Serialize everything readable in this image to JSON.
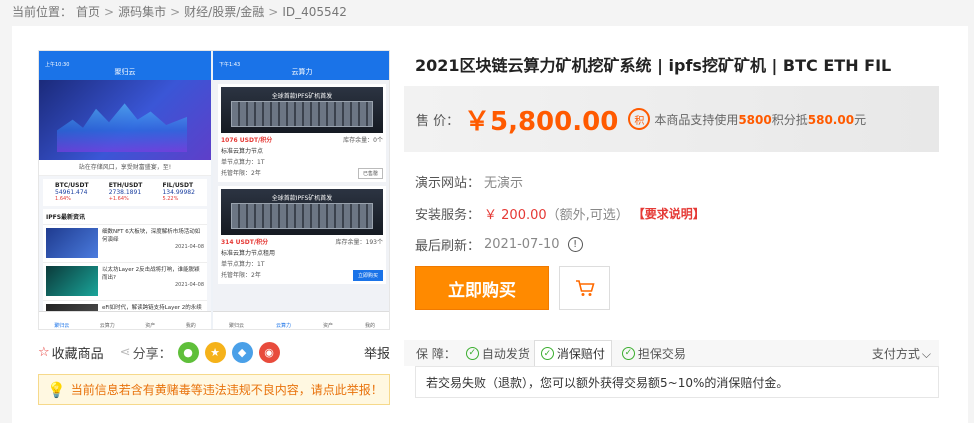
{
  "breadcrumb": {
    "label": "当前位置：",
    "items": [
      "首页",
      "源码集市",
      "财经/股票/金融",
      "ID_405542"
    ],
    "separator": ">"
  },
  "product": {
    "title": "2021区块链云算力矿机挖矿系统 | ipfs挖矿矿机 | BTC ETH FIL",
    "price_label": "售 价：",
    "price": "￥5,800.00",
    "points_icon": "积",
    "points_prefix": "本商品支持使用",
    "points_amount": "5800",
    "points_mid": "积分抵",
    "points_value": "580.00",
    "points_suffix": "元",
    "demo_label": "演示网站：",
    "demo_value": "无演示",
    "install_label": "安装服务：",
    "install_price": "￥ 200.00",
    "install_note": "（额外,可选）",
    "install_req": "【要求说明】",
    "refresh_label": "最后刷新：",
    "refresh_date": "2021-07-10",
    "refresh_icon": "!",
    "buy_label": "立即购买"
  },
  "share": {
    "favorite": "收藏商品",
    "share_label": "分享：",
    "report": "举报",
    "icons": [
      "wechat-icon",
      "qzone-icon",
      "qq-icon",
      "weibo-icon"
    ],
    "icon_colors": [
      "#5fbf3a",
      "#f5b21a",
      "#4aa0e8",
      "#e84b3c"
    ]
  },
  "warning": "当前信息若含有黄赌毒等违法违规不良内容，请点此举报！",
  "guarantee": {
    "label": "保 障：",
    "items": [
      "自动发货",
      "消保赔付",
      "担保交易"
    ],
    "pay_label": "支付方式",
    "description": "若交易失败（退款），您可以额外获得交易额5~10%的消保赔付金。"
  },
  "screenshot": {
    "p1": {
      "status": "上午10:30",
      "header": "聚归云",
      "notice": "站在存储风口，享受财富盛宴，至!",
      "coins": [
        {
          "name": "BTC/USDT",
          "value": "54961.474",
          "change": "1.64%"
        },
        {
          "name": "ETH/USDT",
          "value": "2738.1891",
          "change": "+1.64%"
        },
        {
          "name": "FIL/USDT",
          "value": "134.99982",
          "change": "5.22%"
        }
      ],
      "news_title": "IPFS最新资讯",
      "news": [
        {
          "text": "细数NFT 6大板块，深度解析市场活动如何演绎",
          "date": "2021-04-08"
        },
        {
          "text": "以太坊Layer 2反击战将打响，谁能脱颖而出?",
          "date": "2021-04-08"
        },
        {
          "text": "eFi如时代，解读跨链支持Layer 2的永续合约DEX",
          "date": "2021-03-08"
        }
      ],
      "tabs": [
        "聚归云",
        "云算力",
        "资产",
        "我的"
      ]
    },
    "p2": {
      "status": "下午1:43",
      "header": "云算力",
      "cards": [
        {
          "banner": "全球首款IPFS矿机首发",
          "price": "1076 USDT/积分",
          "stock": "库存余量：0个",
          "name": "标准云算力节点",
          "unit": "单节点算力：1T",
          "period": "托管年限：2年",
          "btn": "已售罄"
        },
        {
          "banner": "全球首款IPFS矿机首发",
          "price": "314 USDT/积分",
          "stock": "库存余量：193个",
          "name": "标准云算力节点租用",
          "unit": "单节点算力：1T",
          "period": "托管年限：2年",
          "btn": "立即购买"
        }
      ],
      "tabs": [
        "聚归云",
        "云算力",
        "资产",
        "我的"
      ]
    }
  }
}
